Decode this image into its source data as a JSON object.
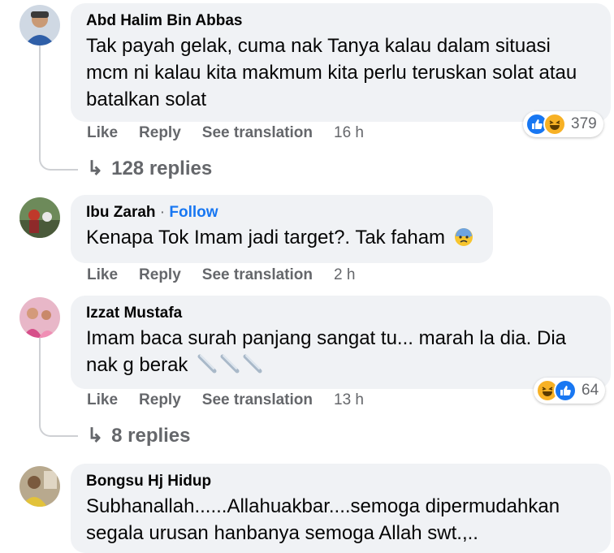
{
  "comments": [
    {
      "author": "Abd Halim Bin Abbas",
      "text_lines": [
        "Tak payah gelak, cuma nak Tanya kalau dalam situasi",
        "mcm ni kalau kita makmum kita perlu teruskan solat atau",
        "batalkan solat"
      ],
      "like": "Like",
      "reply": "Reply",
      "translate": "See translation",
      "time": "16 h",
      "reaction_count": "379",
      "replies": "128 replies"
    },
    {
      "author": "Ibu Zarah",
      "follow": "Follow",
      "text": "Kenapa Tok Imam jadi target?. Tak faham",
      "like": "Like",
      "reply": "Reply",
      "translate": "See translation",
      "time": "2 h"
    },
    {
      "author": "Izzat Mustafa",
      "text_lines": [
        "Imam baca surah panjang sangat tu... marah la dia. Dia",
        "nak g berak"
      ],
      "like": "Like",
      "reply": "Reply",
      "translate": "See translation",
      "time": "13 h",
      "reaction_count": "64",
      "replies": "8 replies"
    },
    {
      "author": "Bongsu Hj Hidup",
      "text_lines": [
        "Subhanallah......Allahuakbar....semoga dipermudahkan",
        "segala urusan hanbanya semoga Allah swt.,.."
      ]
    }
  ],
  "icons": {
    "reply_arrow": "reply-arrow-icon",
    "like_reaction": "like-reaction-icon",
    "haha_reaction": "haha-reaction-icon",
    "anxious_emoji": "anxious-face-emoji",
    "sweat_emoji": "sweat-droplets-emoji"
  },
  "colors": {
    "link": "#1877f2",
    "muted": "#65676b",
    "bubble": "#f0f2f5"
  }
}
